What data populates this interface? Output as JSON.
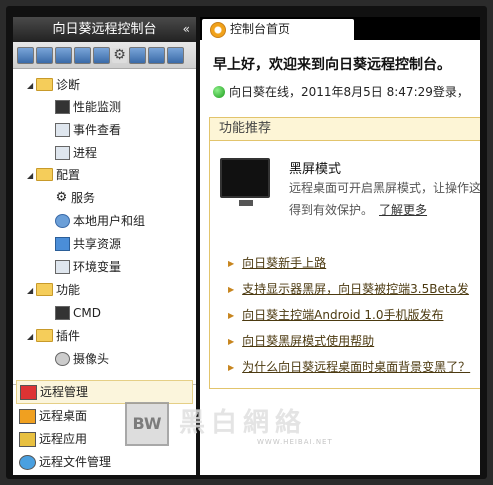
{
  "sidebar": {
    "title": "向日葵远程控制台",
    "collapse_glyph": "«",
    "tree": {
      "diagnose": {
        "label": "诊断",
        "children": [
          "性能监测",
          "事件查看",
          "进程"
        ]
      },
      "config": {
        "label": "配置",
        "children": [
          "服务",
          "本地用户和组",
          "共享资源",
          "环境变量"
        ]
      },
      "function": {
        "label": "功能",
        "children": [
          "CMD"
        ]
      },
      "plugin": {
        "label": "插件",
        "children": [
          "摄像头"
        ]
      }
    },
    "bottom_items": [
      "远程管理",
      "远程桌面",
      "远程应用",
      "远程文件管理"
    ]
  },
  "tab": {
    "label": "控制台首页"
  },
  "greeting": "早上好，欢迎来到向日葵远程控制台。",
  "status": "向日葵在线，2011年8月5日 8:47:29登录，",
  "recommend": {
    "header": "功能推荐",
    "feature_title": "黑屏模式",
    "feature_desc_1": "远程桌面可开启黑屏模式，让操作这",
    "feature_desc_2": "得到有效保护。",
    "learn_more": "了解更多",
    "links": [
      "向日葵新手上路",
      "支持显示器黑屏，向日葵被控端3.5Beta发",
      "向日葵主控端Android 1.0手机版发布",
      "向日葵黑屏模式使用帮助",
      "为什么向日葵远程桌面时桌面背景变黑了？"
    ]
  },
  "watermark": {
    "badge": "BW",
    "text": "黑白網絡",
    "sub": "WWW.HEIBAI.NET"
  },
  "colors": {
    "accent_gold": "#e2c46c",
    "online_green": "#1a9a1a",
    "folder_yellow": "#f5cd5a"
  }
}
